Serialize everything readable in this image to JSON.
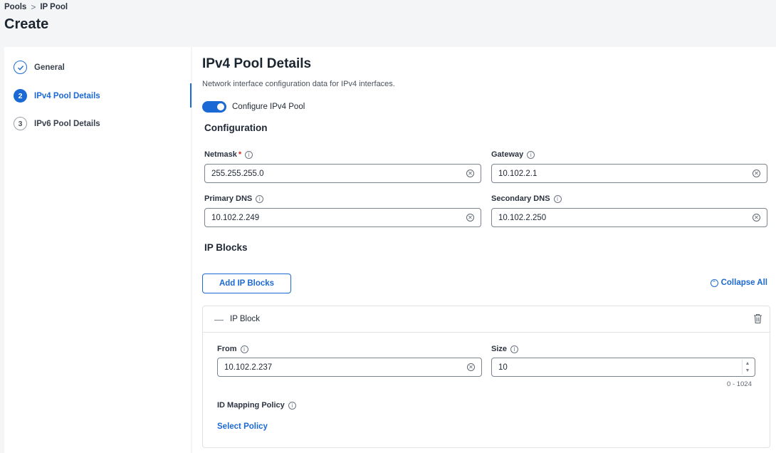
{
  "breadcrumb": {
    "items": [
      "Pools",
      "IP Pool"
    ],
    "separator": ">"
  },
  "page_title": "Create",
  "steps": [
    {
      "number": "",
      "label": "General",
      "state": "done"
    },
    {
      "number": "2",
      "label": "IPv4 Pool Details",
      "state": "active"
    },
    {
      "number": "3",
      "label": "IPv6 Pool Details",
      "state": "pending"
    }
  ],
  "section": {
    "title": "IPv4 Pool Details",
    "description": "Network interface configuration data for IPv4 interfaces.",
    "toggle_label": "Configure IPv4 Pool",
    "toggle_on": true
  },
  "configuration": {
    "title": "Configuration",
    "netmask": {
      "label": "Netmask",
      "required_mark": "*",
      "value": "255.255.255.0"
    },
    "gateway": {
      "label": "Gateway",
      "value": "10.102.2.1"
    },
    "primary_dns": {
      "label": "Primary DNS",
      "value": "10.102.2.249"
    },
    "secondary_dns": {
      "label": "Secondary DNS",
      "value": "10.102.2.250"
    }
  },
  "ip_blocks": {
    "title": "IP Blocks",
    "add_button": "Add IP Blocks",
    "collapse_all": "Collapse All",
    "block": {
      "title": "IP Block",
      "from": {
        "label": "From",
        "value": "10.102.2.237"
      },
      "size": {
        "label": "Size",
        "value": "10",
        "range_hint": "0 - 1024"
      },
      "id_mapping_policy": {
        "label": "ID Mapping Policy",
        "link": "Select Policy"
      }
    }
  },
  "colors": {
    "accent": "#1b69d4",
    "required": "#d0271d"
  },
  "icons": {
    "info": "info-icon",
    "clear": "clear-icon",
    "trash": "trash-icon",
    "check": "check-icon",
    "collapse": "collapse-icon"
  }
}
